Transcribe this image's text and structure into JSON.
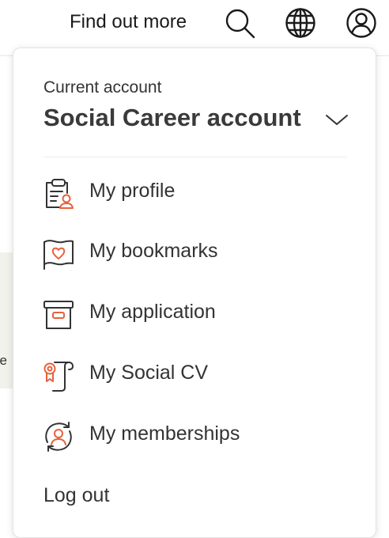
{
  "header": {
    "find_out_more": "Find out more",
    "icons": [
      "search-icon",
      "globe-icon",
      "user-account-icon"
    ]
  },
  "background": {
    "partial_text": "ge"
  },
  "account_menu": {
    "current_label": "Current account",
    "account_name": "Social Career account",
    "items": [
      {
        "label": "My profile",
        "icon": "profile-clipboard-icon"
      },
      {
        "label": "My bookmarks",
        "icon": "heart-flag-icon"
      },
      {
        "label": "My application",
        "icon": "archive-box-icon"
      },
      {
        "label": "My Social CV",
        "icon": "award-scroll-icon"
      },
      {
        "label": "My memberships",
        "icon": "user-refresh-icon"
      }
    ],
    "logout_label": "Log out"
  },
  "colors": {
    "accent": "#e8603c",
    "icon_stroke": "#333333",
    "text": "#333333"
  }
}
